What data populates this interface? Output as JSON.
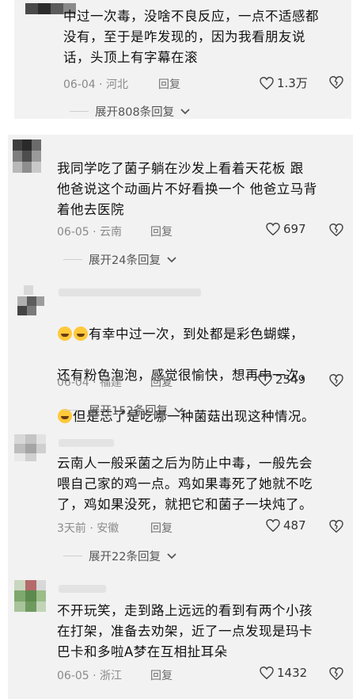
{
  "comments": [
    {
      "text": "中过一次毒，没啥不良反应，一点不适感都\n没有，至于是咋发现的，因为我看朋友说\n话，头顶上有字幕在滚",
      "date": "06-04",
      "location": "河北",
      "reply_label": "回复",
      "likes": "1.3万",
      "expand": "展开808条回复"
    },
    {
      "text": "我同学吃了菌子躺在沙发上看着天花板  跟\n他爸说这个动画片不好看换一个  他爸立马背\n着他去医院",
      "date": "06-05",
      "location": "云南",
      "reply_label": "回复",
      "likes": "697",
      "expand": "展开24条回复"
    },
    {
      "text_line1": "有幸中过一次，到处都是彩色蝴蝶，",
      "text_line2": "还有粉色泡泡，感觉很愉快，想再中一次，",
      "text_line3": "但是忘了是吃哪一种菌菇出现这种情况。",
      "date": "06-04",
      "location": "福建",
      "reply_label": "回复",
      "likes": "2549",
      "expand": "展开152条回复"
    },
    {
      "text": "云南人一般采菌之后为防止中毒，一般先会\n喂自己家的鸡一点。鸡如果毒死了她就不吃\n了，鸡如果没死，就把它和菌子一块炖了。",
      "date": "3天前",
      "location": "安徽",
      "reply_label": "回复",
      "likes": "487",
      "expand": "展开22条回复"
    },
    {
      "text": "不开玩笑，走到路上远远的看到有两个小孩\n在打架，准备去劝架，近了一点发现是玛卡\n巴卡和多啦A梦在互相扯耳朵",
      "date": "06-05",
      "location": "浙江",
      "reply_label": "回复",
      "likes": "1432"
    }
  ],
  "meta_separator": "·",
  "icons": {
    "like": "heart-icon",
    "dislike": "broken-heart-icon",
    "expand": "chevron-down-icon",
    "emoji": "laughing-emoji-icon"
  }
}
